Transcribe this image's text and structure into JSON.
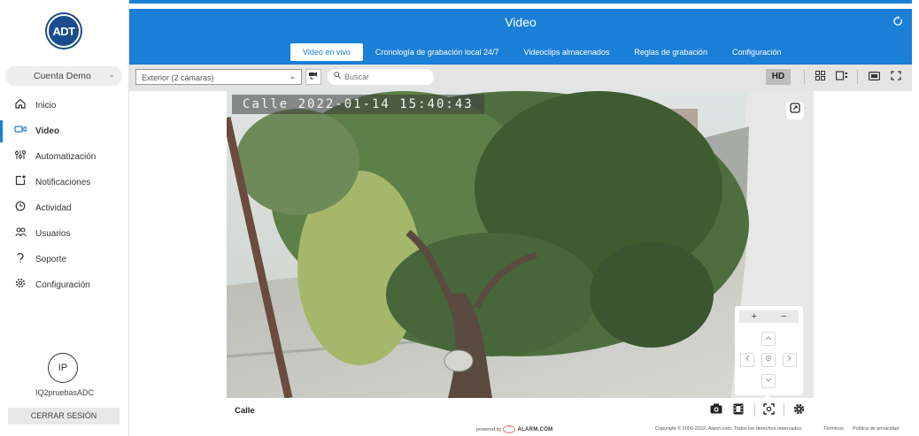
{
  "brand": {
    "logo_text": "ADT"
  },
  "sidebar": {
    "account": "Cuenta Demo",
    "items": [
      {
        "label": "Inicio",
        "icon": "home-icon",
        "active": false
      },
      {
        "label": "Video",
        "icon": "video-camera-icon",
        "active": true
      },
      {
        "label": "Automatización",
        "icon": "sliders-icon",
        "active": false
      },
      {
        "label": "Notificaciones",
        "icon": "notification-icon",
        "active": false
      },
      {
        "label": "Actividad",
        "icon": "clock-icon",
        "active": false
      },
      {
        "label": "Usuarios",
        "icon": "users-icon",
        "active": false
      },
      {
        "label": "Soporte",
        "icon": "support-icon",
        "active": false
      },
      {
        "label": "Configuración",
        "icon": "gear-icon",
        "active": false
      }
    ],
    "user_initials": "IP",
    "user_name": "IQ2pruebasADC",
    "logout_label": "CERRAR SESIÓN"
  },
  "header": {
    "title": "Video",
    "tabs": [
      {
        "label": "Video en vivo",
        "active": true
      },
      {
        "label": "Cronología de grabación local 24/7",
        "active": false
      },
      {
        "label": "Videoclips almacenados",
        "active": false
      },
      {
        "label": "Reglas de grabación",
        "active": false
      },
      {
        "label": "Configuración",
        "active": false
      }
    ]
  },
  "toolbar": {
    "camera_select": "Exterior (2 cámaras)",
    "search_placeholder": "Buscar",
    "hd_label": "HD"
  },
  "video": {
    "timestamp": "Calle 2022-01-14 15:40:43",
    "camera_name": "Calle",
    "zoom_in": "+",
    "zoom_out": "−"
  },
  "footer": {
    "powered_by": "powered by",
    "alarm_brand": "ALARM.COM",
    "copyright": "Copyright © 2000-2022, Alarm.com. Todos los derechos reservados.",
    "terms": "Términos",
    "privacy": "Política de privacidad"
  },
  "colors": {
    "accent": "#1a7fd6",
    "brand": "#1a4b8c"
  }
}
